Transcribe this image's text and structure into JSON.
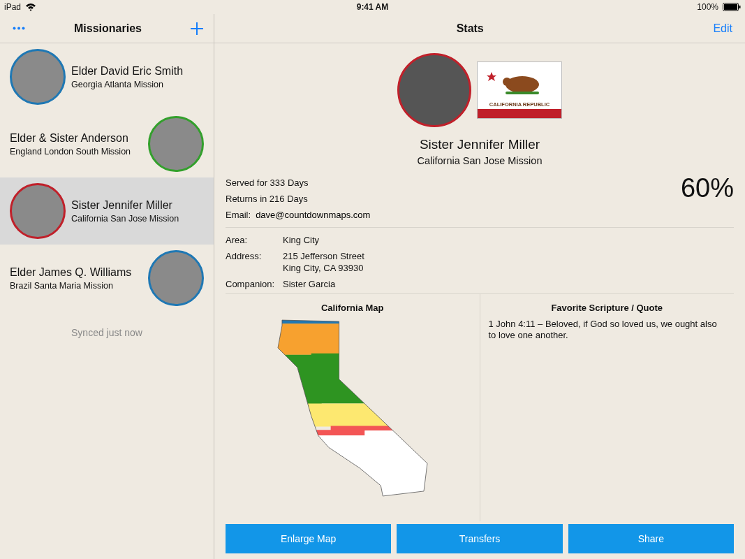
{
  "status_bar": {
    "device": "iPad",
    "time": "9:41 AM",
    "battery": "100%"
  },
  "sidebar": {
    "title": "Missionaries",
    "synced": "Synced just now",
    "items": [
      {
        "name": "Elder David Eric Smith",
        "mission": "Georgia Atlanta Mission",
        "kind": "leading",
        "color": "#1f78b4",
        "selected": false
      },
      {
        "name": "Elder & Sister Anderson",
        "mission": "England London South Mission",
        "kind": "trailing",
        "color": "#33a02c",
        "selected": false
      },
      {
        "name": "Sister Jennifer Miller",
        "mission": "California San Jose Mission",
        "kind": "leading",
        "color": "#c0202a",
        "selected": true
      },
      {
        "name": "Elder James Q. Williams",
        "mission": "Brazil Santa Maria Mission",
        "kind": "trailing",
        "color": "#1f78b4",
        "selected": false
      }
    ]
  },
  "detail": {
    "title": "Stats",
    "edit": "Edit",
    "name": "Sister Jennifer Miller",
    "mission": "California San Jose Mission",
    "color": "#c0202a",
    "flag_caption": "CALIFORNIA REPUBLIC",
    "served": "Served for 333 Days",
    "returns": "Returns in 216 Days",
    "email_label": "Email:",
    "email": "dave@countdownmaps.com",
    "percent": "60%",
    "fields": [
      {
        "label": "Area:",
        "lines": [
          "King City"
        ]
      },
      {
        "label": "Address:",
        "lines": [
          "215 Jefferson Street",
          "King City, CA 93930"
        ]
      },
      {
        "label": "Companion:",
        "lines": [
          "Sister Garcia"
        ]
      }
    ],
    "map_title": "California Map",
    "quote_title": "Favorite Scripture / Quote",
    "quote": "1 John 4:11 – Beloved, if God so loved us, we ought also to love one another.",
    "buttons": [
      "Enlarge Map",
      "Transfers",
      "Share"
    ]
  }
}
